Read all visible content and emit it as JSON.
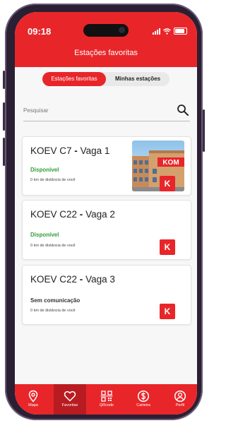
{
  "status_bar": {
    "time": "09:18"
  },
  "header": {
    "title": "Estações favoritas"
  },
  "tabs": [
    {
      "label": "Estações favoritas",
      "active": true
    },
    {
      "label": "Minhas estações",
      "active": false
    }
  ],
  "search": {
    "placeholder": "Pesquisar",
    "icon": "search-icon"
  },
  "cards": [
    {
      "title_station": "KOEV C7",
      "title_sep": "-",
      "title_spot": "Vaga 1",
      "status": "Disponível",
      "status_color": "#2e9e3a",
      "distance": "0 km de distância de você",
      "image_sign": "KOM"
    },
    {
      "title_station": "KOEV C22",
      "title_sep": "-",
      "title_spot": "Vaga 2",
      "status": "Disponível",
      "status_color": "#2e9e3a",
      "distance": "0 km de distância de você"
    },
    {
      "title_station": "KOEV C22",
      "title_sep": "-",
      "title_spot": "Vaga 3",
      "status": "Sem comunicação",
      "status_color": "#333333",
      "distance": "0 km de distância de você"
    }
  ],
  "badge_letter": "K",
  "nav": [
    {
      "label": "Mapa",
      "icon": "map-pin-icon",
      "active": false
    },
    {
      "label": "Favoritas",
      "icon": "heart-icon",
      "active": true
    },
    {
      "label": "QRcode",
      "icon": "qrcode-icon",
      "active": false
    },
    {
      "label": "Carteira",
      "icon": "wallet-dollar-icon",
      "active": false
    },
    {
      "label": "Perfil",
      "icon": "profile-icon",
      "active": false
    }
  ],
  "colors": {
    "brand_red": "#e8262a",
    "active_nav": "#b91c20",
    "available_green": "#2e9e3a"
  }
}
